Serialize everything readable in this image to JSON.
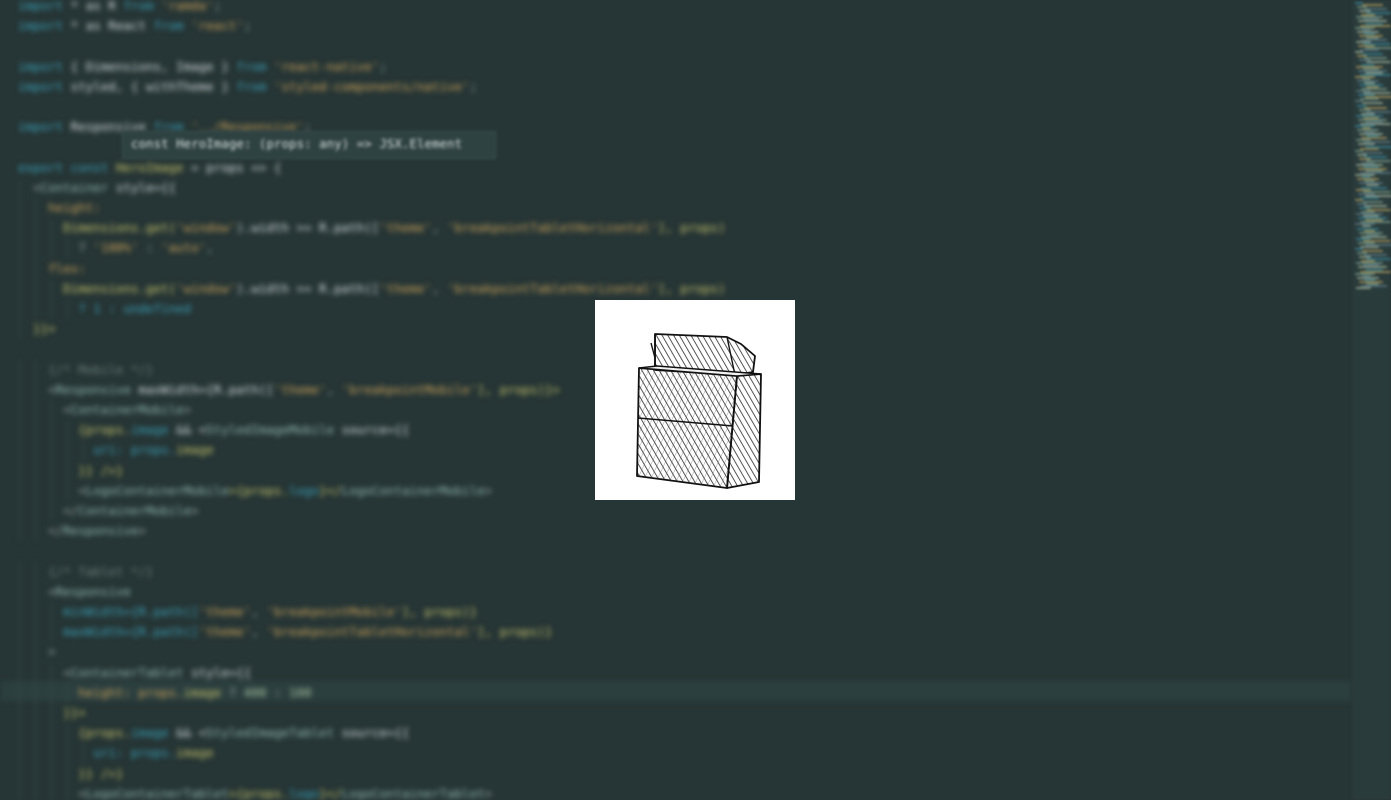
{
  "editor": {
    "lines": [
      [
        {
          "t": "import",
          "c": "kw"
        },
        {
          "t": " * as R ",
          "c": "id"
        },
        {
          "t": "from",
          "c": "kw"
        },
        {
          "t": " 'ramda'",
          "c": "str"
        },
        {
          "t": ";",
          "c": "pn"
        }
      ],
      [
        {
          "t": "import",
          "c": "kw"
        },
        {
          "t": " * as React ",
          "c": "id"
        },
        {
          "t": "from",
          "c": "kw"
        },
        {
          "t": " 'react'",
          "c": "str"
        },
        {
          "t": ";",
          "c": "pn"
        }
      ],
      [],
      [
        {
          "t": "import",
          "c": "kw"
        },
        {
          "t": " { Dimensions, Image } ",
          "c": "id"
        },
        {
          "t": "from",
          "c": "kw"
        },
        {
          "t": " 'react-native'",
          "c": "str"
        },
        {
          "t": ";",
          "c": "pn"
        }
      ],
      [
        {
          "t": "import",
          "c": "kw"
        },
        {
          "t": " styled, { withTheme } ",
          "c": "id"
        },
        {
          "t": "from",
          "c": "kw"
        },
        {
          "t": " 'styled-components/native'",
          "c": "str"
        },
        {
          "t": ";",
          "c": "pn"
        }
      ],
      [],
      [
        {
          "t": "import",
          "c": "kw"
        },
        {
          "t": " Responsive ",
          "c": "id"
        },
        {
          "t": "from",
          "c": "kw"
        },
        {
          "t": " '../Responsive'",
          "c": "str"
        },
        {
          "t": ";",
          "c": "pn"
        }
      ],
      [],
      [
        {
          "t": "export const ",
          "c": "kw"
        },
        {
          "t": "HeroImage",
          "c": "fn"
        },
        {
          "t": " = props => {",
          "c": "id"
        }
      ],
      [
        {
          "t": "  <",
          "c": "pn"
        },
        {
          "t": "Container",
          "c": "tag"
        },
        {
          "t": " style={{",
          "c": "id"
        }
      ],
      [
        {
          "t": "    height:",
          "c": "str"
        }
      ],
      [
        {
          "t": "      Dimensions.get(",
          "c": "fn"
        },
        {
          "t": "'window'",
          "c": "str"
        },
        {
          "t": ").width >= R.path([",
          "c": "id"
        },
        {
          "t": "'theme'",
          "c": "str"
        },
        {
          "t": ", ",
          "c": "pn"
        },
        {
          "t": "'breakpointTabletHorizontal'",
          "c": "str"
        },
        {
          "t": "], props)",
          "c": "fn"
        }
      ],
      [
        {
          "t": "        ? ",
          "c": "pn"
        },
        {
          "t": "'100%'",
          "c": "str"
        },
        {
          "t": " : ",
          "c": "pn"
        },
        {
          "t": "'auto'",
          "c": "str"
        },
        {
          "t": ",",
          "c": "pn"
        }
      ],
      [
        {
          "t": "    flex:",
          "c": "str"
        }
      ],
      [
        {
          "t": "      Dimensions.get(",
          "c": "fn"
        },
        {
          "t": "'window'",
          "c": "str"
        },
        {
          "t": ").width >= R.path([",
          "c": "id"
        },
        {
          "t": "'theme'",
          "c": "str"
        },
        {
          "t": ", ",
          "c": "pn"
        },
        {
          "t": "'breakpointTabletHorizontal'",
          "c": "str"
        },
        {
          "t": "], props)",
          "c": "fn"
        }
      ],
      [
        {
          "t": "        ? 1 : undefined",
          "c": "kw"
        }
      ],
      [
        {
          "t": "  }}>",
          "c": "fn"
        }
      ],
      [],
      [
        {
          "t": "    {/* Mobile */}",
          "c": "cm"
        }
      ],
      [
        {
          "t": "    <",
          "c": "pn"
        },
        {
          "t": "Responsive",
          "c": "tag"
        },
        {
          "t": " maxWidth={R.path([",
          "c": "id"
        },
        {
          "t": "'theme'",
          "c": "str"
        },
        {
          "t": ", ",
          "c": "pn"
        },
        {
          "t": "'breakpointMobile'",
          "c": "str"
        },
        {
          "t": "], props)}>",
          "c": "fn"
        }
      ],
      [
        {
          "t": "      <",
          "c": "pn"
        },
        {
          "t": "ContainerMobile",
          "c": "tag"
        },
        {
          "t": ">",
          "c": "pn"
        }
      ],
      [
        {
          "t": "        {props.",
          "c": "fn"
        },
        {
          "t": "image",
          "c": "kw"
        },
        {
          "t": " && <",
          "c": "id"
        },
        {
          "t": "StyledImageMobile",
          "c": "tag"
        },
        {
          "t": " source={{",
          "c": "id"
        }
      ],
      [
        {
          "t": "          uri: props.",
          "c": "kw"
        },
        {
          "t": "image",
          "c": "fn"
        }
      ],
      [
        {
          "t": "        }} />}",
          "c": "fn"
        }
      ],
      [
        {
          "t": "        <",
          "c": "pn"
        },
        {
          "t": "LogoContainerMobile",
          "c": "tag"
        },
        {
          "t": ">{props.",
          "c": "fn"
        },
        {
          "t": "logo",
          "c": "kw"
        },
        {
          "t": "}</",
          "c": "fn"
        },
        {
          "t": "LogoContainerMobile",
          "c": "tag"
        },
        {
          "t": ">",
          "c": "pn"
        }
      ],
      [
        {
          "t": "      </",
          "c": "pn"
        },
        {
          "t": "ContainerMobile",
          "c": "tag"
        },
        {
          "t": ">",
          "c": "pn"
        }
      ],
      [
        {
          "t": "    </",
          "c": "pn"
        },
        {
          "t": "Responsive",
          "c": "tag"
        },
        {
          "t": ">",
          "c": "pn"
        }
      ],
      [],
      [
        {
          "t": "    {/* Tablet */}",
          "c": "cm"
        }
      ],
      [
        {
          "t": "    <",
          "c": "pn"
        },
        {
          "t": "Responsive",
          "c": "tag"
        }
      ],
      [
        {
          "t": "      minWidth={R.path([",
          "c": "kw"
        },
        {
          "t": "'theme'",
          "c": "str"
        },
        {
          "t": ", ",
          "c": "pn"
        },
        {
          "t": "'breakpointMobile'",
          "c": "str"
        },
        {
          "t": "], props)}",
          "c": "fn"
        }
      ],
      [
        {
          "t": "      maxWidth={R.path([",
          "c": "kw"
        },
        {
          "t": "'theme'",
          "c": "str"
        },
        {
          "t": ", ",
          "c": "pn"
        },
        {
          "t": "'breakpointTabletHorizontal'",
          "c": "str"
        },
        {
          "t": "], props)}",
          "c": "fn"
        }
      ],
      [
        {
          "t": "    >",
          "c": "pn"
        }
      ],
      [
        {
          "t": "      <",
          "c": "pn"
        },
        {
          "t": "ContainerTablet",
          "c": "tag"
        },
        {
          "t": " style={{",
          "c": "id"
        }
      ],
      [
        {
          "t": "        height: props.",
          "c": "str"
        },
        {
          "t": "image",
          "c": "fn"
        },
        {
          "t": " ? ",
          "c": "pn"
        },
        {
          "t": "400",
          "c": "num"
        },
        {
          "t": " : ",
          "c": "pn"
        },
        {
          "t": "100",
          "c": "num"
        }
      ],
      [
        {
          "t": "      }}>",
          "c": "fn"
        }
      ],
      [
        {
          "t": "        {props.",
          "c": "fn"
        },
        {
          "t": "image",
          "c": "kw"
        },
        {
          "t": " && <",
          "c": "id"
        },
        {
          "t": "StyledImageTablet",
          "c": "tag"
        },
        {
          "t": " source={{",
          "c": "id"
        }
      ],
      [
        {
          "t": "          uri: props.",
          "c": "kw"
        },
        {
          "t": "image",
          "c": "fn"
        }
      ],
      [
        {
          "t": "        }} />}",
          "c": "fn"
        }
      ],
      [
        {
          "t": "        <",
          "c": "pn"
        },
        {
          "t": "LogoContainerTablet",
          "c": "tag"
        },
        {
          "t": ">{props.",
          "c": "fn"
        },
        {
          "t": "logo",
          "c": "kw"
        },
        {
          "t": "}</",
          "c": "fn"
        },
        {
          "t": "LogoContainerTablet",
          "c": "tag"
        },
        {
          "t": ">",
          "c": "pn"
        }
      ]
    ]
  },
  "tooltip": {
    "text": "const HeroImage: (props: any) => JSX.Element"
  },
  "colors": {
    "background": "#263535",
    "keyword": "#3a9fb7",
    "string": "#c9a15a",
    "function": "#c6c26b",
    "comment": "#6a7f7c"
  }
}
